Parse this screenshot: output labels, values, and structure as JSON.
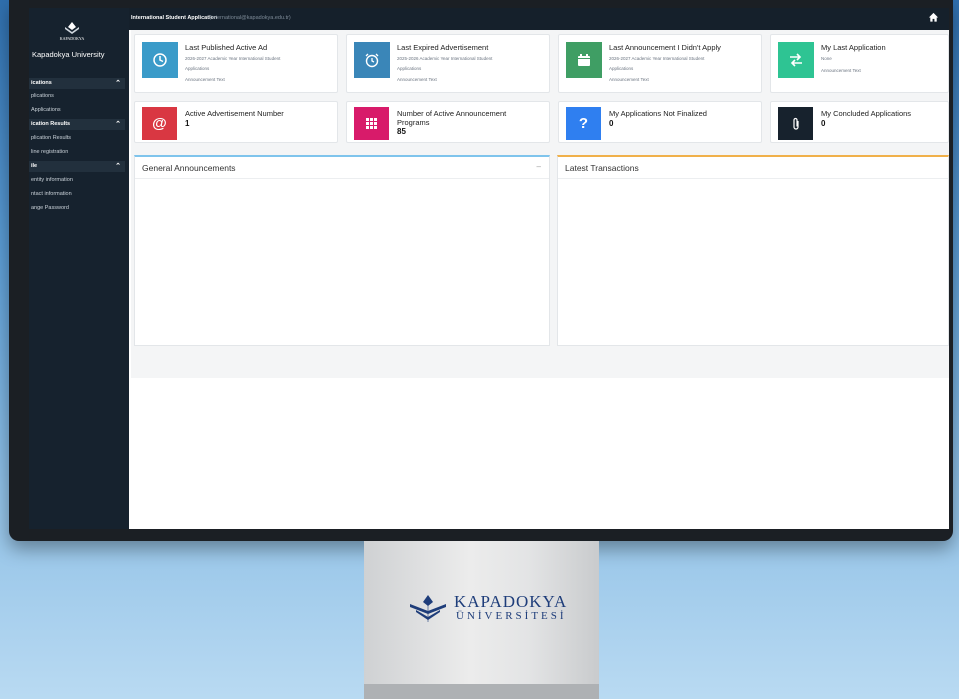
{
  "topbar": {
    "app_title": "International Student Application",
    "app_subtitle": "- (international@kapadokya.edu.tr)"
  },
  "sidebar": {
    "logo_text": "KAPADOKYA",
    "university_name": "Kapadokya University",
    "sections": [
      {
        "label": "ications",
        "items": [
          "plications",
          "Applications"
        ]
      },
      {
        "label": "ication Results",
        "items": [
          "plication Results",
          "line registration"
        ]
      },
      {
        "label": "ile",
        "items": [
          "entity information",
          "ntact information",
          "ange Password"
        ]
      }
    ]
  },
  "cards_row1": [
    {
      "title": "Last Published Active Ad",
      "line1": "2026-2027 Academic Year International Student",
      "line2": "Applications",
      "line3": "Announcement Text",
      "color": "#3a9bc9",
      "icon": "clock-icon"
    },
    {
      "title": "Last Expired Advertisement",
      "line1": "2025-2026 Academic Year International Student",
      "line2": "Applications",
      "line3": "Announcement Text",
      "color": "#3a86b8",
      "icon": "alarm-icon"
    },
    {
      "title": "Last Announcement I Didn't Apply",
      "line1": "2026-2027 Academic Year International Student",
      "line2": "Applications",
      "line3": "Announcement Text",
      "color": "#3f9e64",
      "icon": "calendar-icon"
    },
    {
      "title": "My Last Application",
      "line1": "None",
      "line2": "Announcement Text",
      "line3": "",
      "color": "#2ec493",
      "icon": "exchange-icon"
    }
  ],
  "cards_row2": [
    {
      "title": "Active Advertisement Number",
      "value": "1",
      "color": "#d93742",
      "icon": "at-icon"
    },
    {
      "title": "Number of Active Announcement",
      "title2": "Programs",
      "value": "85",
      "color": "#d81b6a",
      "icon": "grid-icon"
    },
    {
      "title": "My Applications Not Finalized",
      "value": "0",
      "color": "#2f7ff0",
      "icon": "question-icon"
    },
    {
      "title": "My Concluded Applications",
      "value": "0",
      "color": "#17222d",
      "icon": "paperclip-icon"
    }
  ],
  "panels": {
    "announcements_title": "General Announcements",
    "announcements_collapse": "–",
    "transactions_title": "Latest Transactions",
    "announcements_accent": "#7fc4ec",
    "transactions_accent": "#f0b04a"
  },
  "stand": {
    "brand_line1": "KAPADOKYA",
    "brand_line2": "ÜNİVERSİTESİ"
  }
}
